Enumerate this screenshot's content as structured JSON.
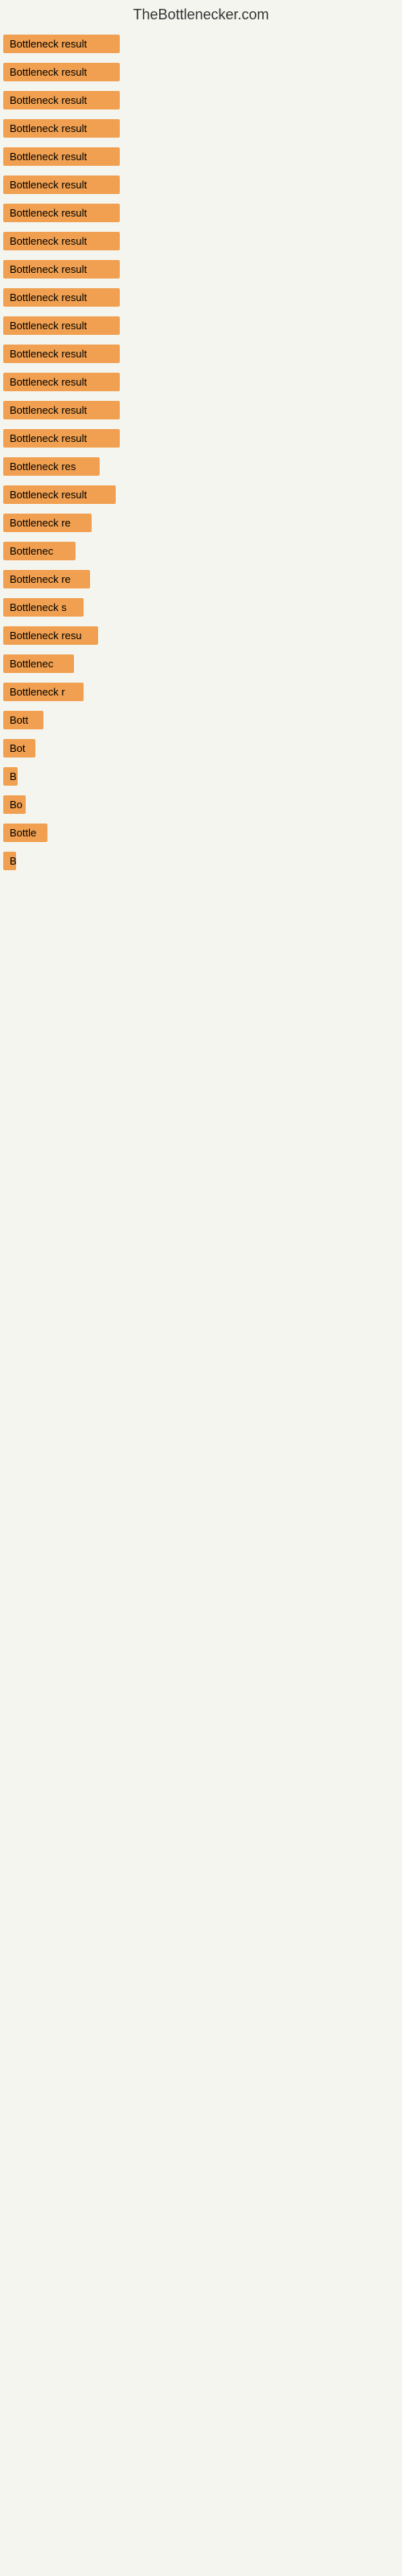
{
  "site": {
    "title": "TheBottlenecker.com"
  },
  "items": [
    {
      "label": "Bottleneck result",
      "width": 145
    },
    {
      "label": "Bottleneck result",
      "width": 145
    },
    {
      "label": "Bottleneck result",
      "width": 145
    },
    {
      "label": "Bottleneck result",
      "width": 145
    },
    {
      "label": "Bottleneck result",
      "width": 145
    },
    {
      "label": "Bottleneck result",
      "width": 145
    },
    {
      "label": "Bottleneck result",
      "width": 145
    },
    {
      "label": "Bottleneck result",
      "width": 145
    },
    {
      "label": "Bottleneck result",
      "width": 145
    },
    {
      "label": "Bottleneck result",
      "width": 145
    },
    {
      "label": "Bottleneck result",
      "width": 145
    },
    {
      "label": "Bottleneck result",
      "width": 145
    },
    {
      "label": "Bottleneck result",
      "width": 145
    },
    {
      "label": "Bottleneck result",
      "width": 145
    },
    {
      "label": "Bottleneck result",
      "width": 145
    },
    {
      "label": "Bottleneck res",
      "width": 120
    },
    {
      "label": "Bottleneck result",
      "width": 140
    },
    {
      "label": "Bottleneck re",
      "width": 110
    },
    {
      "label": "Bottlenec",
      "width": 90
    },
    {
      "label": "Bottleneck re",
      "width": 108
    },
    {
      "label": "Bottleneck s",
      "width": 100
    },
    {
      "label": "Bottleneck resu",
      "width": 118
    },
    {
      "label": "Bottlenec",
      "width": 88
    },
    {
      "label": "Bottleneck r",
      "width": 100
    },
    {
      "label": "Bott",
      "width": 50
    },
    {
      "label": "Bot",
      "width": 40
    },
    {
      "label": "B",
      "width": 18
    },
    {
      "label": "Bo",
      "width": 28
    },
    {
      "label": "Bottle",
      "width": 55
    },
    {
      "label": "B",
      "width": 14
    }
  ]
}
